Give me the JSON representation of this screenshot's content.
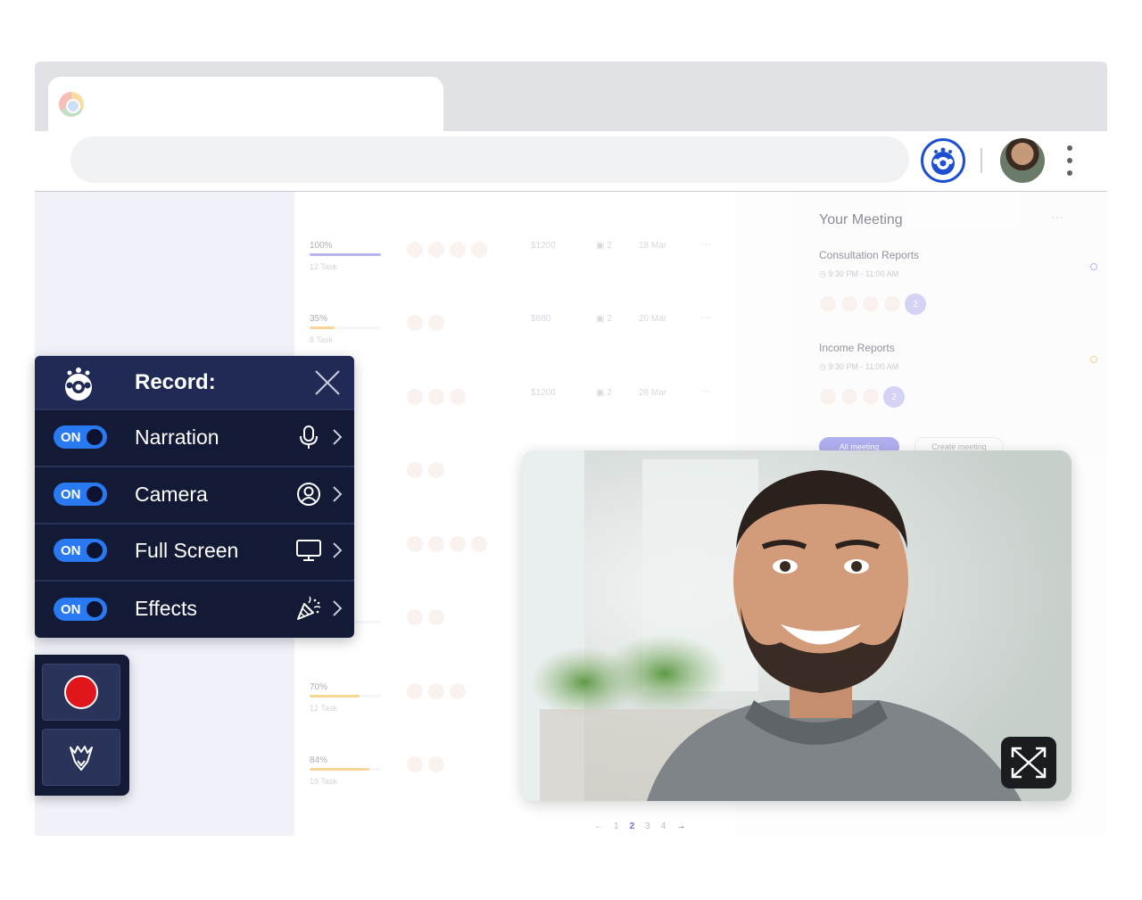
{
  "browser": {
    "tab_title": "",
    "address": ""
  },
  "tasks": [
    {
      "percent": "100%",
      "tasks": "12 Task",
      "fill": 1.0,
      "color": "#7b79e6",
      "avatars": 4,
      "price": "$1200",
      "attachments": "2",
      "date": "18 Mar"
    },
    {
      "percent": "35%",
      "tasks": "8 Task",
      "fill": 0.35,
      "color": "#f2b544",
      "avatars": 2,
      "price": "$680",
      "attachments": "2",
      "date": "20 Mar"
    },
    {
      "percent": "",
      "tasks": "",
      "fill": 0,
      "color": "#f2b544",
      "avatars": 3,
      "price": "$1200",
      "attachments": "2",
      "date": "28 Mar"
    },
    {
      "percent": "",
      "tasks": "",
      "fill": 0,
      "color": "#f2b544",
      "avatars": 2,
      "price": "",
      "attachments": "",
      "date": ""
    },
    {
      "percent": "",
      "tasks": "",
      "fill": 0,
      "color": "#7b79e6",
      "avatars": 4,
      "price": "",
      "attachments": "",
      "date": ""
    },
    {
      "percent": "",
      "tasks": "8 Task",
      "fill": 0,
      "color": "#f2b544",
      "avatars": 2,
      "price": "",
      "attachments": "",
      "date": ""
    },
    {
      "percent": "70%",
      "tasks": "12 Task",
      "fill": 0.7,
      "color": "#f2b544",
      "avatars": 3,
      "price": "",
      "attachments": "",
      "date": ""
    },
    {
      "percent": "84%",
      "tasks": "19 Task",
      "fill": 0.84,
      "color": "#f2b544",
      "avatars": 2,
      "price": "",
      "attachments": "",
      "date": ""
    }
  ],
  "pager": {
    "prev": "←",
    "pages": [
      "1",
      "2",
      "3",
      "4"
    ],
    "current": "2",
    "next": "→"
  },
  "meeting": {
    "title": "Your Meeting",
    "more": "···",
    "items": [
      {
        "title": "Consultation Reports",
        "time": "9:30 PM - 11:00 AM",
        "avatars": 4,
        "badge": "2",
        "dot_color": "#8a87e8"
      },
      {
        "title": "Income Reports",
        "time": "9:30 PM - 11:00 AM",
        "avatars": 3,
        "badge": "2",
        "dot_color": "#f2b544"
      }
    ],
    "buttons": {
      "all": "All meeting",
      "create": "Create meeting"
    }
  },
  "record_panel": {
    "title": "Record:",
    "rows": [
      {
        "toggle": "ON",
        "label": "Narration",
        "icon": "microphone-icon"
      },
      {
        "toggle": "ON",
        "label": "Camera",
        "icon": "user-circle-icon"
      },
      {
        "toggle": "ON",
        "label": "Full Screen",
        "icon": "monitor-icon"
      },
      {
        "toggle": "ON",
        "label": "Effects",
        "icon": "party-popper-icon"
      }
    ]
  },
  "controls": {
    "record": "record-button",
    "effects": "pen-effects-icon"
  },
  "colors": {
    "panel_bg": "#131a36",
    "panel_header": "#202a55",
    "toggle_on": "#2979f2",
    "record_red": "#e1161c",
    "brand_blue": "#1f4fd1"
  }
}
